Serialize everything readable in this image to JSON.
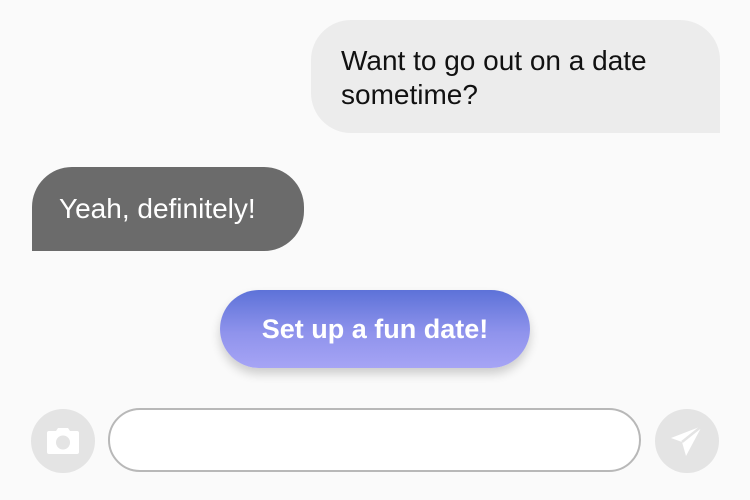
{
  "conversation": {
    "messages": [
      {
        "from": "me",
        "text": "Want to go out on a date sometime?"
      },
      {
        "from": "them",
        "text": "Yeah, definitely!"
      }
    ]
  },
  "action": {
    "label": "Set up a fun date!"
  },
  "composer": {
    "input_value": "",
    "camera_icon": "camera-icon",
    "send_icon": "send-icon"
  },
  "colors": {
    "background": "#fafafa",
    "sent_bubble": "#ececec",
    "received_bubble": "#6b6b6b",
    "cta_top": "#5d72d8",
    "cta_bottom": "#a6a4f5",
    "icon_button": "#e4e4e4",
    "icon_glyph": "#ffffff"
  }
}
